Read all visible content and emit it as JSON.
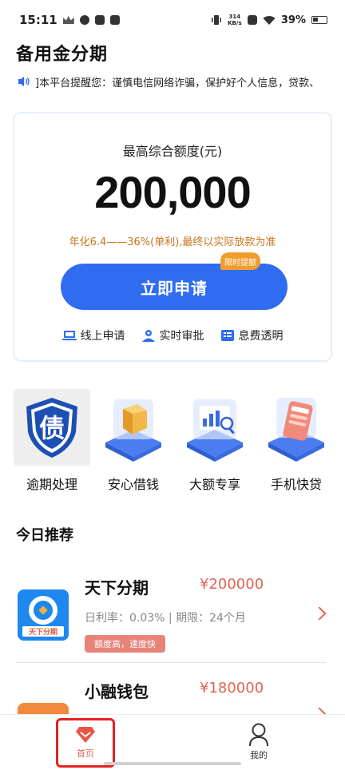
{
  "status_bar": {
    "time": "15:11",
    "net_speed_value": "314",
    "net_speed_unit": "KB/s",
    "battery": "39%"
  },
  "page": {
    "title": "备用金分期"
  },
  "notice": {
    "text": "]本平台提醒您：谨慎电信网络诈骗，保护好个人信息，贷款、"
  },
  "credit_card": {
    "limit_label": "最高综合额度(元)",
    "limit_amount": "200,000",
    "rate_note": "年化6.4——36%(单利),最终以实际放款为准",
    "apply_label": "立即申请",
    "promo_badge": "限时提额",
    "features": [
      {
        "label": "线上申请",
        "icon": "laptop-icon"
      },
      {
        "label": "实时审批",
        "icon": "person-icon"
      },
      {
        "label": "息费透明",
        "icon": "receipt-icon"
      }
    ]
  },
  "categories": [
    {
      "label": "逾期处理",
      "icon": "debt-shield-icon",
      "glyph": "债"
    },
    {
      "label": "安心借钱",
      "icon": "shield-box-icon"
    },
    {
      "label": "大额专享",
      "icon": "chart-card-icon"
    },
    {
      "label": "手机快贷",
      "icon": "phone-card-icon"
    }
  ],
  "recommend": {
    "title": "今日推荐",
    "products": [
      {
        "name": "天下分期",
        "amount": "¥200000",
        "meta": "日利率：0.03% | 期限：24个月",
        "tag": "额度高，速度快",
        "logo_text": "天下分期"
      },
      {
        "name": "小融钱包",
        "amount": "¥180000"
      }
    ]
  },
  "bottom_nav": {
    "home_label": "首页",
    "mine_label": "我的"
  },
  "colors": {
    "primary_blue": "#2f6cf0",
    "price_red": "#e06452",
    "rate_orange": "#c8741c",
    "highlight_red": "#e32222"
  }
}
